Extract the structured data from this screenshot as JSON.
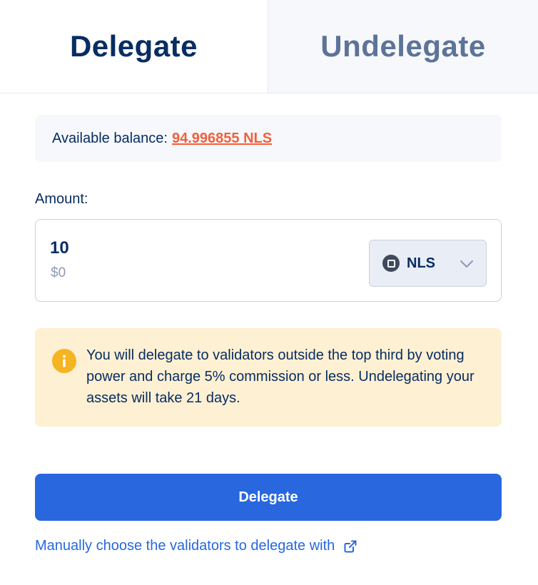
{
  "tabs": {
    "delegate_label": "Delegate",
    "undelegate_label": "Undelegate"
  },
  "balance": {
    "label": "Available balance:",
    "value": "94.996855 NLS"
  },
  "amount": {
    "label": "Amount:",
    "value": "10",
    "usd_value": "$0",
    "token": {
      "name": "NLS",
      "icon": "token-square-icon"
    }
  },
  "warning": {
    "icon": "info-icon",
    "text": "You will delegate to validators outside the top third by voting power and charge 5% commission or less. Undelegating your assets will take 21 days."
  },
  "actions": {
    "delegate_button_label": "Delegate",
    "manual_link_label": "Manually choose the validators to delegate with",
    "manual_link_icon": "external-link-icon"
  },
  "colors": {
    "primary": "#2867DE",
    "title": "#082D63",
    "balance_highlight": "#F0603B",
    "warning_bg": "#FEF0D2",
    "warning_icon": "#F5B421"
  }
}
